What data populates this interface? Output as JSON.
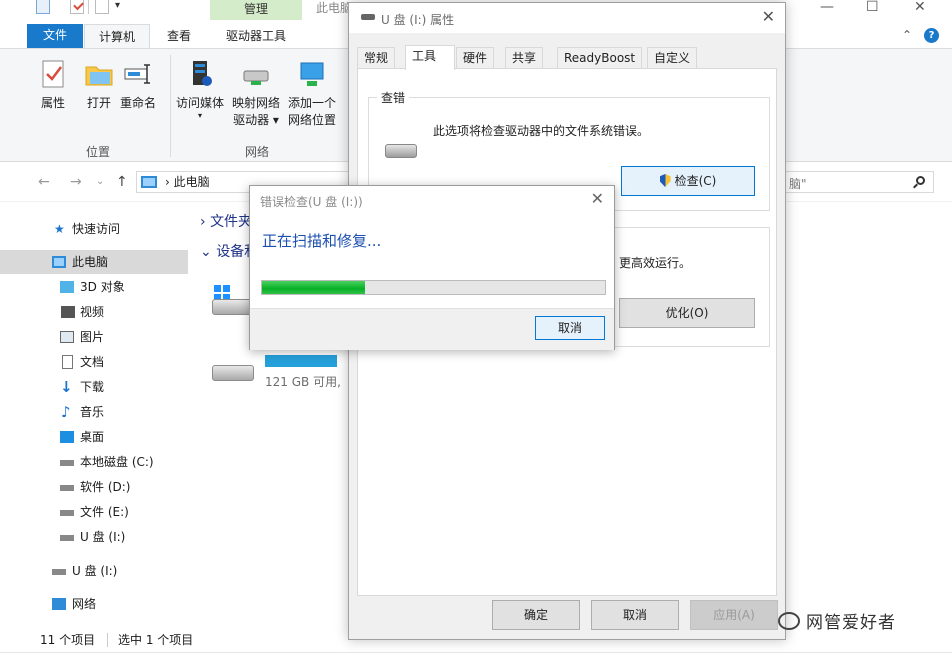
{
  "explorer": {
    "title_context": "管理",
    "title_partial": "此电脑",
    "window_controls": {
      "minimize": "—",
      "maximize": "☐",
      "close": "✕"
    },
    "tabs": {
      "file": "文件",
      "computer": "计算机",
      "view": "查看",
      "drive_tools": "驱动器工具"
    },
    "ribbon": {
      "properties": "属性",
      "open": "打开",
      "rename": "重命名",
      "media_access": "访问媒体",
      "map_drive_1": "映射网络",
      "map_drive_2": "驱动器 ▾",
      "add_location_1": "添加一个",
      "add_location_2": "网络位置",
      "group_location": "位置",
      "group_network": "网络"
    },
    "address": {
      "path": "此电脑",
      "separator": "›"
    },
    "search": {
      "text": "脑\""
    },
    "nav": {
      "quick_access": "快速访问",
      "this_pc": "此电脑",
      "objects3d": "3D 对象",
      "videos": "视频",
      "pictures": "图片",
      "documents": "文档",
      "downloads": "下载",
      "music": "音乐",
      "desktop": "桌面",
      "local_c": "本地磁盘 (C:)",
      "soft_d": "软件 (D:)",
      "file_e": "文件 (E:)",
      "usb_i": "U 盘 (I:)",
      "usb_i_root": "U 盘 (I:)",
      "network": "网络"
    },
    "content": {
      "folders_header": "文件夹",
      "devices_header": "设备和",
      "drive_free": "121 GB 可用,"
    },
    "status": {
      "items": "11 个项目",
      "selected": "选中 1 个项目"
    }
  },
  "properties": {
    "title": "U 盘 (I:) 属性",
    "close": "✕",
    "tabs": [
      "常规",
      "工具",
      "硬件",
      "共享",
      "ReadyBoost",
      "自定义"
    ],
    "check_group": {
      "title": "查错",
      "text": "此选项将检查驱动器中的文件系统错误。",
      "button": "检查(C)"
    },
    "optimize_group": {
      "text_partial": "更高效运行。",
      "button": "优化(O)"
    },
    "buttons": {
      "ok": "确定",
      "cancel": "取消",
      "apply": "应用(A)"
    }
  },
  "error_check": {
    "title": "错误检查(U 盘 (I:))",
    "close": "✕",
    "heading": "正在扫描和修复...",
    "progress": 0.3,
    "cancel": "取消"
  },
  "watermark": {
    "text": "网管爱好者"
  }
}
